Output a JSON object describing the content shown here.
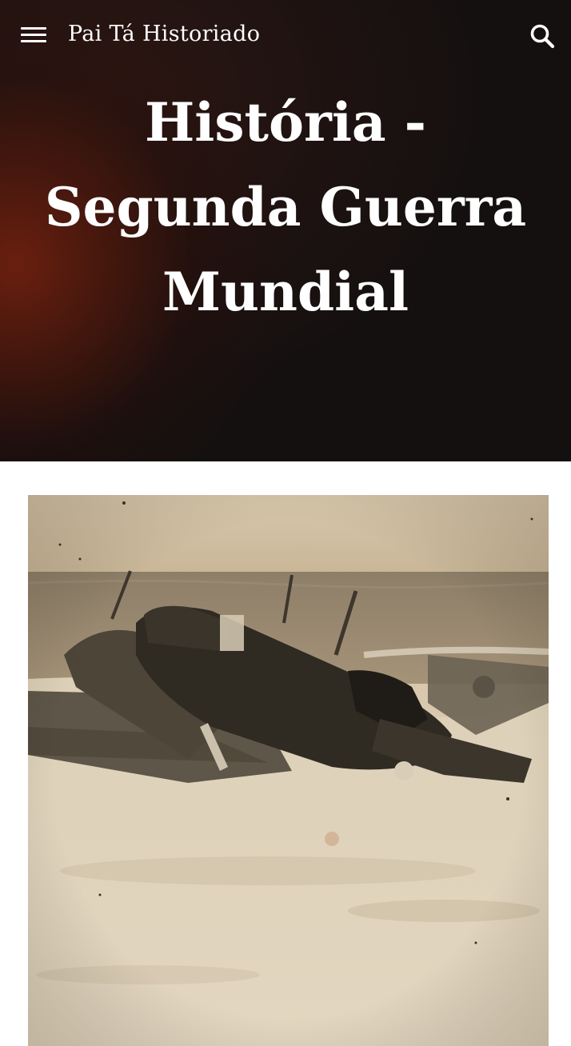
{
  "header": {
    "site_title": "Pai Tá Historiado",
    "menu_icon": "hamburger-menu-icon",
    "search_icon": "search-icon"
  },
  "hero": {
    "title_lines": [
      "História -",
      "Segunda Guerra",
      "Mundial"
    ]
  },
  "colors": {
    "hero_dark": "#141010",
    "hero_accent": "#6e200e",
    "text": "#ffffff",
    "photo_sepia": "#d8c8ad"
  }
}
